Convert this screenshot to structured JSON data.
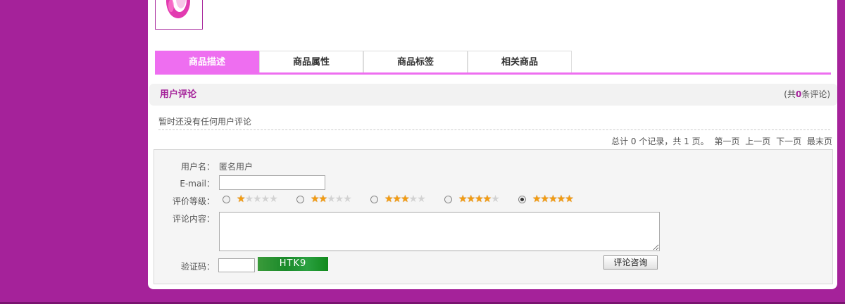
{
  "product": {
    "thumbnail_icon": "pink-band-icon"
  },
  "tabs": [
    {
      "label": "商品描述",
      "active": true
    },
    {
      "label": "商品属性",
      "active": false
    },
    {
      "label": "商品标签",
      "active": false
    },
    {
      "label": "相关商品",
      "active": false
    }
  ],
  "reviews": {
    "title": "用户评论",
    "count_prefix": "(共",
    "count": "0",
    "count_suffix": "条评论)",
    "empty_message": "暂时还没有任何用户评论"
  },
  "pager": {
    "summary": "总计 0 个记录，共 1 页。",
    "first": "第一页",
    "prev": "上一页",
    "next": "下一页",
    "last": "最末页"
  },
  "form": {
    "username_label": "用户名：",
    "username_value": "匿名用户",
    "email_label": "E-mail：",
    "email_value": "",
    "rating_label": "评价等级：",
    "rating_options": [
      1,
      2,
      3,
      4,
      5
    ],
    "rating_selected": 5,
    "content_label": "评论内容：",
    "content_value": "",
    "captcha_label": "验证码：",
    "captcha_value": "",
    "captcha_text": "HTK9",
    "submit_label": "评论咨询"
  },
  "colors": {
    "background": "#a5229a",
    "accent": "#ee6ef0",
    "title": "#a5229a",
    "star": "#f29c11"
  }
}
